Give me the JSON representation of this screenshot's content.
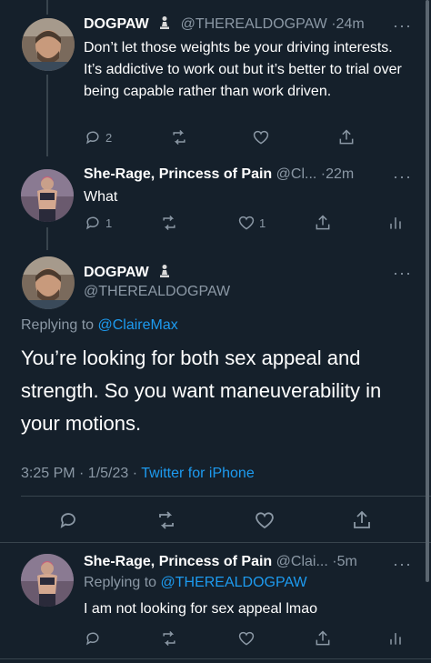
{
  "tweets": [
    {
      "display_name": "DOGPAW",
      "badge_icon": "chess-pawn-icon",
      "handle": "@THEREALDOGPAW",
      "separator": "·",
      "time": "24m",
      "text": "Don’t let those weights be your driving interests. It’s addictive to work out but it’s better to trial over being capable rather than work driven.",
      "reply_count": "2",
      "retweet_count": "",
      "like_count": ""
    },
    {
      "display_name": "She-Rage, Princess of Pain",
      "handle": "@Cl...",
      "separator": "·",
      "time": "22m",
      "text": "What",
      "reply_count": "1",
      "retweet_count": "",
      "like_count": "1"
    }
  ],
  "main_tweet": {
    "display_name": "DOGPAW",
    "badge_icon": "chess-pawn-icon",
    "handle": "@THEREALDOGPAW",
    "replying_prefix": "Replying to",
    "replying_to": "@ClaireMax",
    "text": "You’re looking for both sex appeal and strength. So you want maneuverability in your motions.",
    "timestamp": "3:25 PM · 1/5/23 · ",
    "source": "Twitter for iPhone"
  },
  "reply_tweet": {
    "display_name": "She-Rage, Princess of Pain",
    "handle": "@Clai...",
    "separator": "·",
    "time": "5m",
    "replying_prefix": "Replying to",
    "replying_to": "@THEREALDOGPAW",
    "text": "I am not looking for sex appeal lmao"
  },
  "more_label": "···",
  "colors": {
    "background": "#15202b",
    "text": "#ffffff",
    "secondary": "#8b98a5",
    "link": "#1d9bf0",
    "divider": "#38444d"
  }
}
